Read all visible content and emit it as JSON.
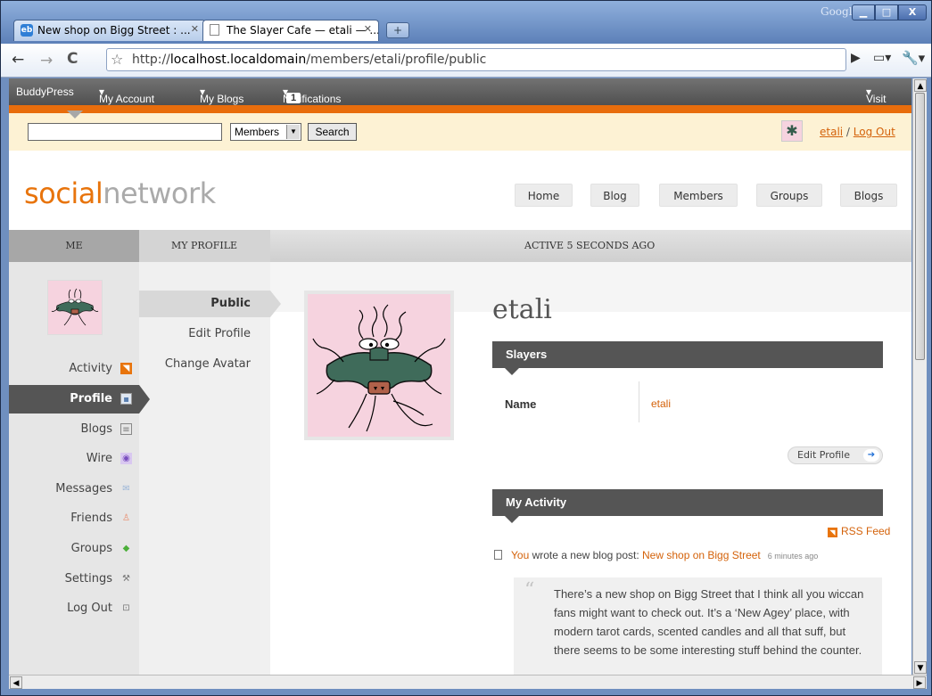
{
  "browser": {
    "tabs": [
      {
        "title": "New shop on Bigg Street : ...",
        "favicon": "eb",
        "active": false
      },
      {
        "title": "The Slayer Cafe — etali — ...",
        "favicon": "page-icon",
        "active": true
      }
    ],
    "new_tab": "+",
    "brand": "Google",
    "url_prefix": "http://",
    "url_host": "localhost.localdomain",
    "url_path": "/members/etali/profile/public"
  },
  "adminbar": {
    "brand": "BuddyPress",
    "my_account": "My Account",
    "my_blogs": "My Blogs",
    "notifications": "Notifications",
    "notif_count": "1",
    "visit": "Visit"
  },
  "search": {
    "value": "",
    "scope": "Members",
    "button": "Search"
  },
  "user": {
    "name": "etali",
    "sep": " / ",
    "logout": "Log Out"
  },
  "site": {
    "logo_part1": "social",
    "logo_part2": "network",
    "nav": [
      "Home",
      "Blog",
      "Members",
      "Groups",
      "Blogs"
    ]
  },
  "tabs": {
    "me": "ME",
    "my_profile": "MY PROFILE",
    "active": "ACTIVE 5 SECONDS AGO"
  },
  "left_nav": [
    {
      "label": "Activity",
      "icon": "rss-icon"
    },
    {
      "label": "Profile",
      "icon": "profile-card-icon"
    },
    {
      "label": "Blogs",
      "icon": "document-icon"
    },
    {
      "label": "Wire",
      "icon": "wire-icon"
    },
    {
      "label": "Messages",
      "icon": "envelope-icon"
    },
    {
      "label": "Friends",
      "icon": "friends-icon"
    },
    {
      "label": "Groups",
      "icon": "cube-icon"
    },
    {
      "label": "Settings",
      "icon": "wrench-icon"
    },
    {
      "label": "Log Out",
      "icon": "lock-icon"
    }
  ],
  "sub_nav": [
    "Public",
    "Edit Profile",
    "Change Avatar"
  ],
  "profile": {
    "name": "etali",
    "section_title": "Slayers",
    "field_label": "Name",
    "field_value": "etali",
    "edit_button": "Edit Profile"
  },
  "activity": {
    "title": "My Activity",
    "rss": "RSS Feed",
    "actor": "You",
    "action": " wrote a new blog post: ",
    "post_title": "New shop on Bigg Street",
    "time": "6 minutes ago",
    "excerpt": "There’s a new shop on Bigg Street that I think all you wiccan fans might want to check out.  It’s a ‘New Agey’ place, with modern tarot cards, scented candles and all that suff, but there seems to be some interesting stuff behind the counter."
  },
  "colors": {
    "accent": "#e8740c",
    "link": "#d4620a",
    "dark_bar": "#555555",
    "avatar_bg": "#f6d3df"
  }
}
